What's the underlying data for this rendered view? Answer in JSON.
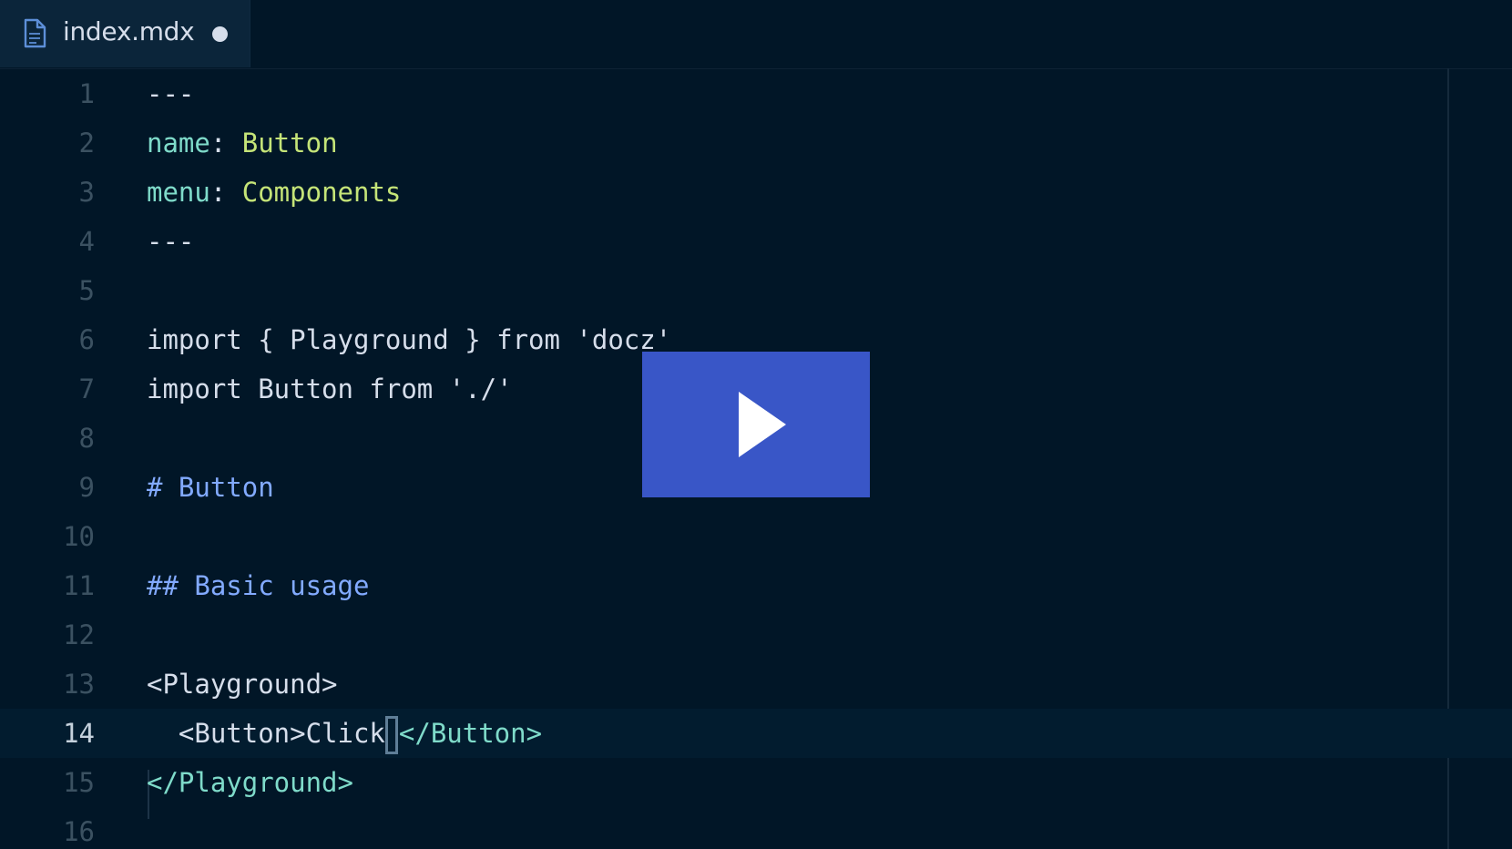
{
  "tab": {
    "filename": "index.mdx",
    "icon": "file-icon",
    "modified": true
  },
  "editor": {
    "active_line": 14,
    "lines": [
      {
        "number": "1",
        "segments": [
          {
            "text": "---",
            "cls": "plain"
          }
        ]
      },
      {
        "number": "2",
        "segments": [
          {
            "text": "name",
            "cls": "key"
          },
          {
            "text": ": ",
            "cls": "plain"
          },
          {
            "text": "Button",
            "cls": "val"
          }
        ]
      },
      {
        "number": "3",
        "segments": [
          {
            "text": "menu",
            "cls": "key"
          },
          {
            "text": ": ",
            "cls": "plain"
          },
          {
            "text": "Components",
            "cls": "val"
          }
        ]
      },
      {
        "number": "4",
        "segments": [
          {
            "text": "---",
            "cls": "plain"
          }
        ]
      },
      {
        "number": "5",
        "segments": []
      },
      {
        "number": "6",
        "segments": [
          {
            "text": "import { Playground } from 'docz'",
            "cls": "plain"
          }
        ]
      },
      {
        "number": "7",
        "segments": [
          {
            "text": "import Button from './'",
            "cls": "plain"
          }
        ]
      },
      {
        "number": "8",
        "segments": []
      },
      {
        "number": "9",
        "segments": [
          {
            "text": "# Button",
            "cls": "head"
          }
        ]
      },
      {
        "number": "10",
        "segments": []
      },
      {
        "number": "11",
        "segments": [
          {
            "text": "## Basic usage",
            "cls": "head"
          }
        ]
      },
      {
        "number": "12",
        "segments": []
      },
      {
        "number": "13",
        "segments": [
          {
            "text": "<Playground>",
            "cls": "plain"
          }
        ]
      },
      {
        "number": "14",
        "segments": [
          {
            "text": "  <Button>Click",
            "cls": "plain"
          },
          {
            "text": "",
            "cls": "cursor"
          },
          {
            "text": "</Button>",
            "cls": "tag"
          }
        ]
      },
      {
        "number": "15",
        "segments": [
          {
            "text": "</Playground>",
            "cls": "tag"
          }
        ]
      },
      {
        "number": "16",
        "segments": []
      }
    ]
  },
  "overlay": {
    "icon": "play-icon",
    "color": "#3956c7"
  },
  "colors": {
    "background": "#011627",
    "key": "#7fdbca",
    "value": "#c5e478",
    "heading": "#82aaff",
    "text": "#d6deeb"
  }
}
